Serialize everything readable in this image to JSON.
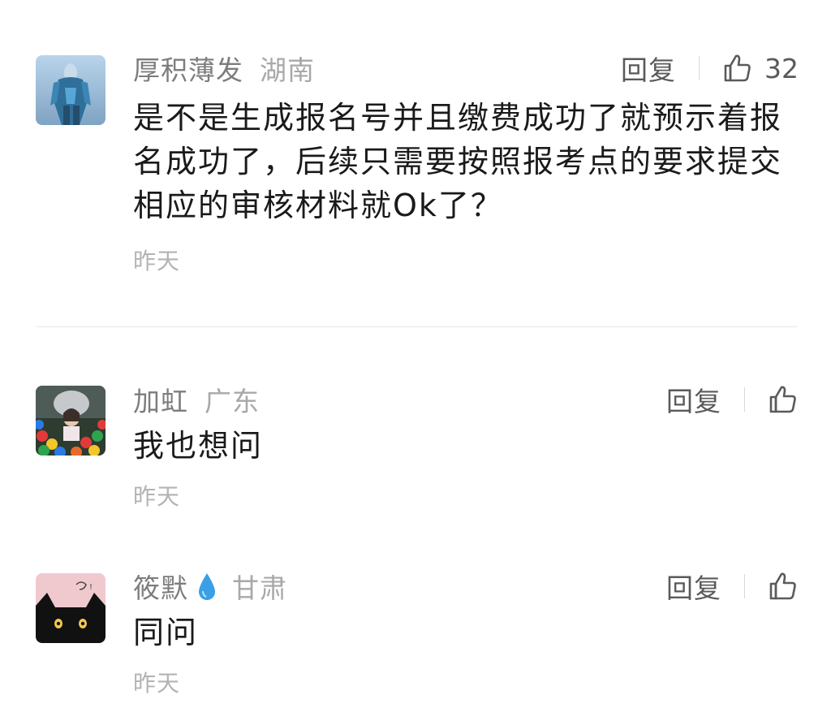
{
  "comments": [
    {
      "username": "厚积薄发",
      "region": "湖南",
      "text": "是不是生成报名号并且缴费成功了就预示着报名成功了，后续只需要按照报考点的要求提交相应的审核材料就Ok了？",
      "time": "昨天",
      "reply_label": "回复",
      "like_count": "32",
      "avatar_icon": "armored-warrior-avatar"
    },
    {
      "username": "加虹",
      "region": "广东",
      "text": "我也想问",
      "time": "昨天",
      "reply_label": "回复",
      "avatar_icon": "ball-pit-photo-avatar"
    },
    {
      "username": "筱默",
      "region": "甘肃",
      "text": "同问",
      "time": "昨天",
      "reply_label": "回复",
      "badge_icon": "water-drop-icon",
      "avatar_icon": "black-cat-avatar"
    }
  ],
  "colors": {
    "badge": "#3aa0e6",
    "muted": "#a8a8a8"
  }
}
